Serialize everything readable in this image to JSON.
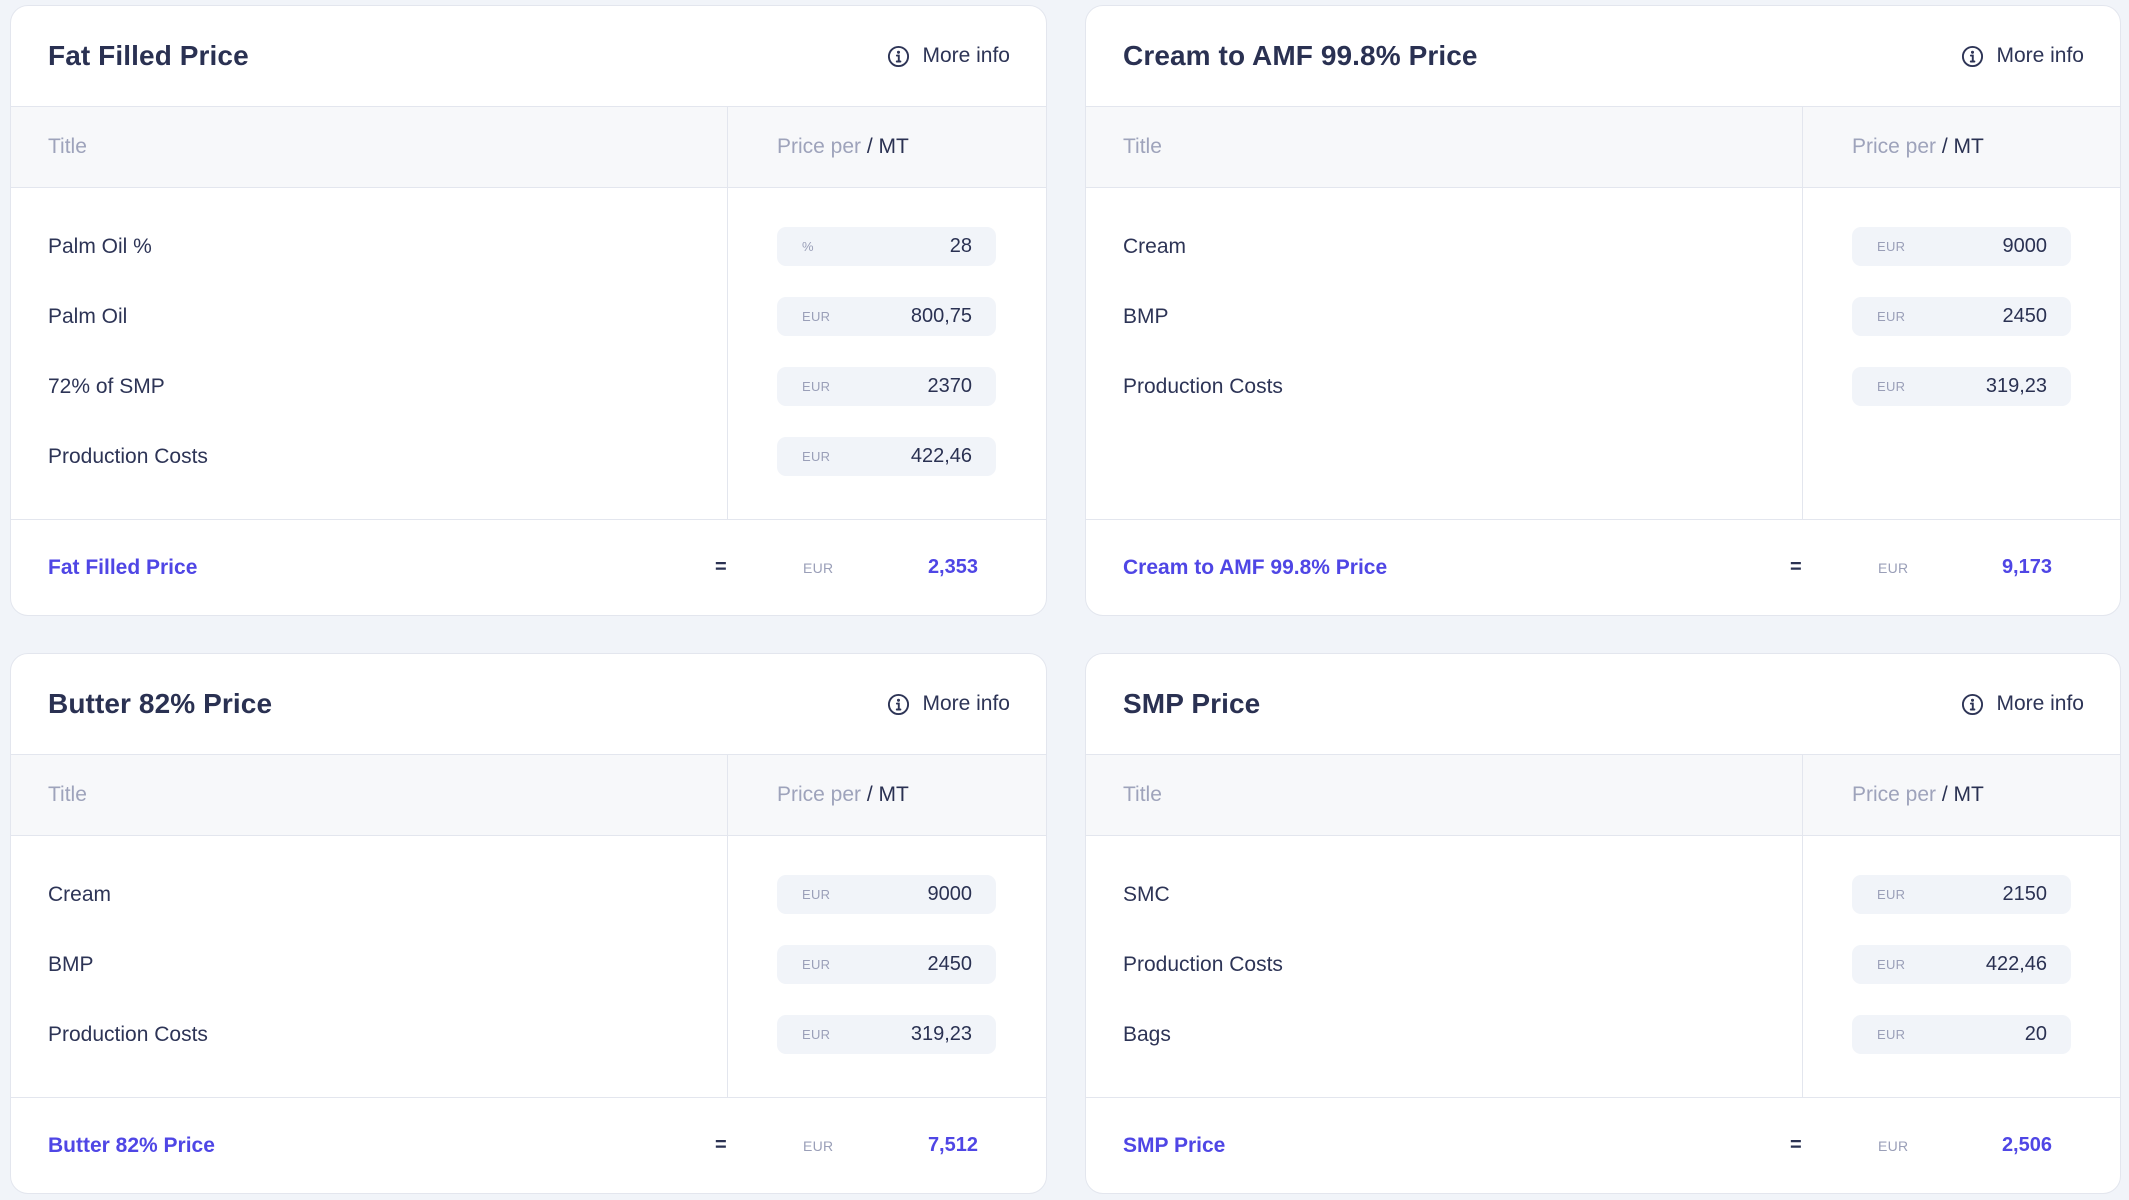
{
  "accent_color": "#4f46e5",
  "cards": [
    {
      "title": "Fat Filled Price",
      "more_info_label": "More info",
      "more_info_icon": "info-circle-icon",
      "columns": {
        "title": "Title",
        "price_prefix": "Price per ",
        "price_unit": "/ MT"
      },
      "rows": [
        {
          "label": "Palm Oil %",
          "unit": "%",
          "value": "28"
        },
        {
          "label": "Palm Oil",
          "unit": "EUR",
          "value": "800,75"
        },
        {
          "label": "72% of SMP",
          "unit": "EUR",
          "value": "2370"
        },
        {
          "label": "Production Costs",
          "unit": "EUR",
          "value": "422,46"
        }
      ],
      "result": {
        "label": "Fat Filled Price",
        "equals": "=",
        "unit": "EUR",
        "value": "2,353"
      }
    },
    {
      "title": "Cream to AMF 99.8% Price",
      "more_info_label": "More info",
      "more_info_icon": "info-circle-icon",
      "columns": {
        "title": "Title",
        "price_prefix": "Price per ",
        "price_unit": "/ MT"
      },
      "rows": [
        {
          "label": "Cream",
          "unit": "EUR",
          "value": "9000"
        },
        {
          "label": "BMP",
          "unit": "EUR",
          "value": "2450"
        },
        {
          "label": "Production Costs",
          "unit": "EUR",
          "value": "319,23"
        }
      ],
      "result": {
        "label": "Cream to AMF 99.8% Price",
        "equals": "=",
        "unit": "EUR",
        "value": "9,173"
      }
    },
    {
      "title": "Butter 82% Price",
      "more_info_label": "More info",
      "more_info_icon": "info-circle-icon",
      "columns": {
        "title": "Title",
        "price_prefix": "Price per ",
        "price_unit": "/ MT"
      },
      "rows": [
        {
          "label": "Cream",
          "unit": "EUR",
          "value": "9000"
        },
        {
          "label": "BMP",
          "unit": "EUR",
          "value": "2450"
        },
        {
          "label": "Production Costs",
          "unit": "EUR",
          "value": "319,23"
        }
      ],
      "result": {
        "label": "Butter 82% Price",
        "equals": "=",
        "unit": "EUR",
        "value": "7,512"
      }
    },
    {
      "title": "SMP Price",
      "more_info_label": "More info",
      "more_info_icon": "info-circle-icon",
      "columns": {
        "title": "Title",
        "price_prefix": "Price per ",
        "price_unit": "/ MT"
      },
      "rows": [
        {
          "label": "SMC",
          "unit": "EUR",
          "value": "2150"
        },
        {
          "label": "Production Costs",
          "unit": "EUR",
          "value": "422,46"
        },
        {
          "label": "Bags",
          "unit": "EUR",
          "value": "20"
        }
      ],
      "result": {
        "label": "SMP Price",
        "equals": "=",
        "unit": "EUR",
        "value": "2,506"
      }
    }
  ]
}
